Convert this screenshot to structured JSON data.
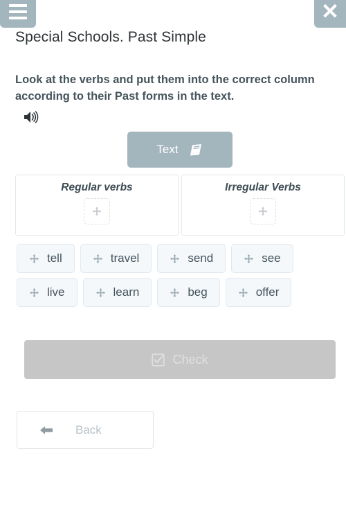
{
  "header": {
    "menu_icon": "hamburger-menu-icon",
    "close_icon": "close-x-icon",
    "title": "Special Schools. Past Simple"
  },
  "instruction": {
    "text": "Look at the verbs and put them into the correct column according to their Past forms in the text.",
    "audio_icon": "speaker-volume-icon"
  },
  "text_button": {
    "label": "Text",
    "icon": "book-icon"
  },
  "panels": [
    {
      "title": "Regular verbs",
      "drop_icon": "move-arrows-icon"
    },
    {
      "title": "Irregular Verbs",
      "drop_icon": "move-arrows-icon"
    }
  ],
  "chips": [
    {
      "label": "tell",
      "icon": "move-arrows-icon"
    },
    {
      "label": "travel",
      "icon": "move-arrows-icon"
    },
    {
      "label": "send",
      "icon": "move-arrows-icon"
    },
    {
      "label": "see",
      "icon": "move-arrows-icon"
    },
    {
      "label": "live",
      "icon": "move-arrows-icon"
    },
    {
      "label": "learn",
      "icon": "move-arrows-icon"
    },
    {
      "label": "beg",
      "icon": "move-arrows-icon"
    },
    {
      "label": "offer",
      "icon": "move-arrows-icon"
    }
  ],
  "check_button": {
    "label": "Check",
    "icon": "checkbox-checked-icon"
  },
  "back_button": {
    "label": "Back",
    "icon": "arrow-left-icon"
  },
  "colors": {
    "accent": "#a3b5bd",
    "title_text": "#2e3436",
    "instruction_text": "#45545c",
    "chip_background": "#f4f8fa",
    "chip_border": "#e1e8ec",
    "check_disabled": "#c6c6c6",
    "back_text": "#b9c3c8"
  }
}
